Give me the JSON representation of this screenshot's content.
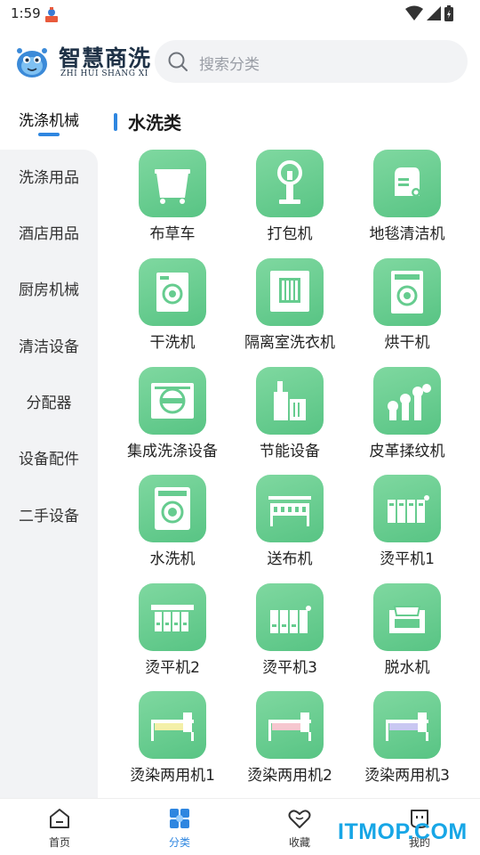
{
  "status_bar": {
    "time": "1:59"
  },
  "header": {
    "logo_cn": "智慧商洗",
    "logo_en": "ZHI HUI SHANG XI",
    "search_placeholder": "搜索分类"
  },
  "sidebar": {
    "items": [
      {
        "label": "洗涤机械",
        "active": true
      },
      {
        "label": "洗涤用品"
      },
      {
        "label": "酒店用品"
      },
      {
        "label": "厨房机械"
      },
      {
        "label": "清洁设备"
      },
      {
        "label": "分配器"
      },
      {
        "label": "设备配件"
      },
      {
        "label": "二手设备"
      }
    ]
  },
  "content": {
    "category_title": "水洗类",
    "items": [
      {
        "label": "布草车",
        "icon": "linen-cart-icon"
      },
      {
        "label": "打包机",
        "icon": "packing-machine-icon"
      },
      {
        "label": "地毯清洁机",
        "icon": "carpet-cleaner-icon"
      },
      {
        "label": "干洗机",
        "icon": "dry-cleaning-machine-icon"
      },
      {
        "label": "隔离室洗衣机",
        "icon": "barrier-washer-icon"
      },
      {
        "label": "烘干机",
        "icon": "dryer-icon"
      },
      {
        "label": "集成洗涤设备",
        "icon": "integrated-washing-icon"
      },
      {
        "label": "节能设备",
        "icon": "energy-saving-icon"
      },
      {
        "label": "皮革揉纹机",
        "icon": "leather-machine-icon"
      },
      {
        "label": "水洗机",
        "icon": "washing-machine-icon"
      },
      {
        "label": "送布机",
        "icon": "cloth-feeder-icon"
      },
      {
        "label": "烫平机1",
        "icon": "ironer-icon"
      },
      {
        "label": "烫平机2",
        "icon": "ironer-icon"
      },
      {
        "label": "烫平机3",
        "icon": "ironer-icon"
      },
      {
        "label": "脱水机",
        "icon": "extractor-icon"
      },
      {
        "label": "烫染两用机1",
        "icon": "iron-dye-machine-icon"
      },
      {
        "label": "烫染两用机2",
        "icon": "iron-dye-machine-icon"
      },
      {
        "label": "烫染两用机3",
        "icon": "iron-dye-machine-icon"
      }
    ]
  },
  "bottom_nav": [
    {
      "label": "首页",
      "icon": "home-icon"
    },
    {
      "label": "分类",
      "icon": "category-icon",
      "active": true
    },
    {
      "label": "收藏",
      "icon": "heart-icon"
    },
    {
      "label": "我的",
      "icon": "profile-icon"
    }
  ],
  "watermark": "ITMOP.COM",
  "colors": {
    "accent": "#2e86e0",
    "tile_green": "#66cc8f",
    "sidebar_bg": "#f2f3f5"
  }
}
